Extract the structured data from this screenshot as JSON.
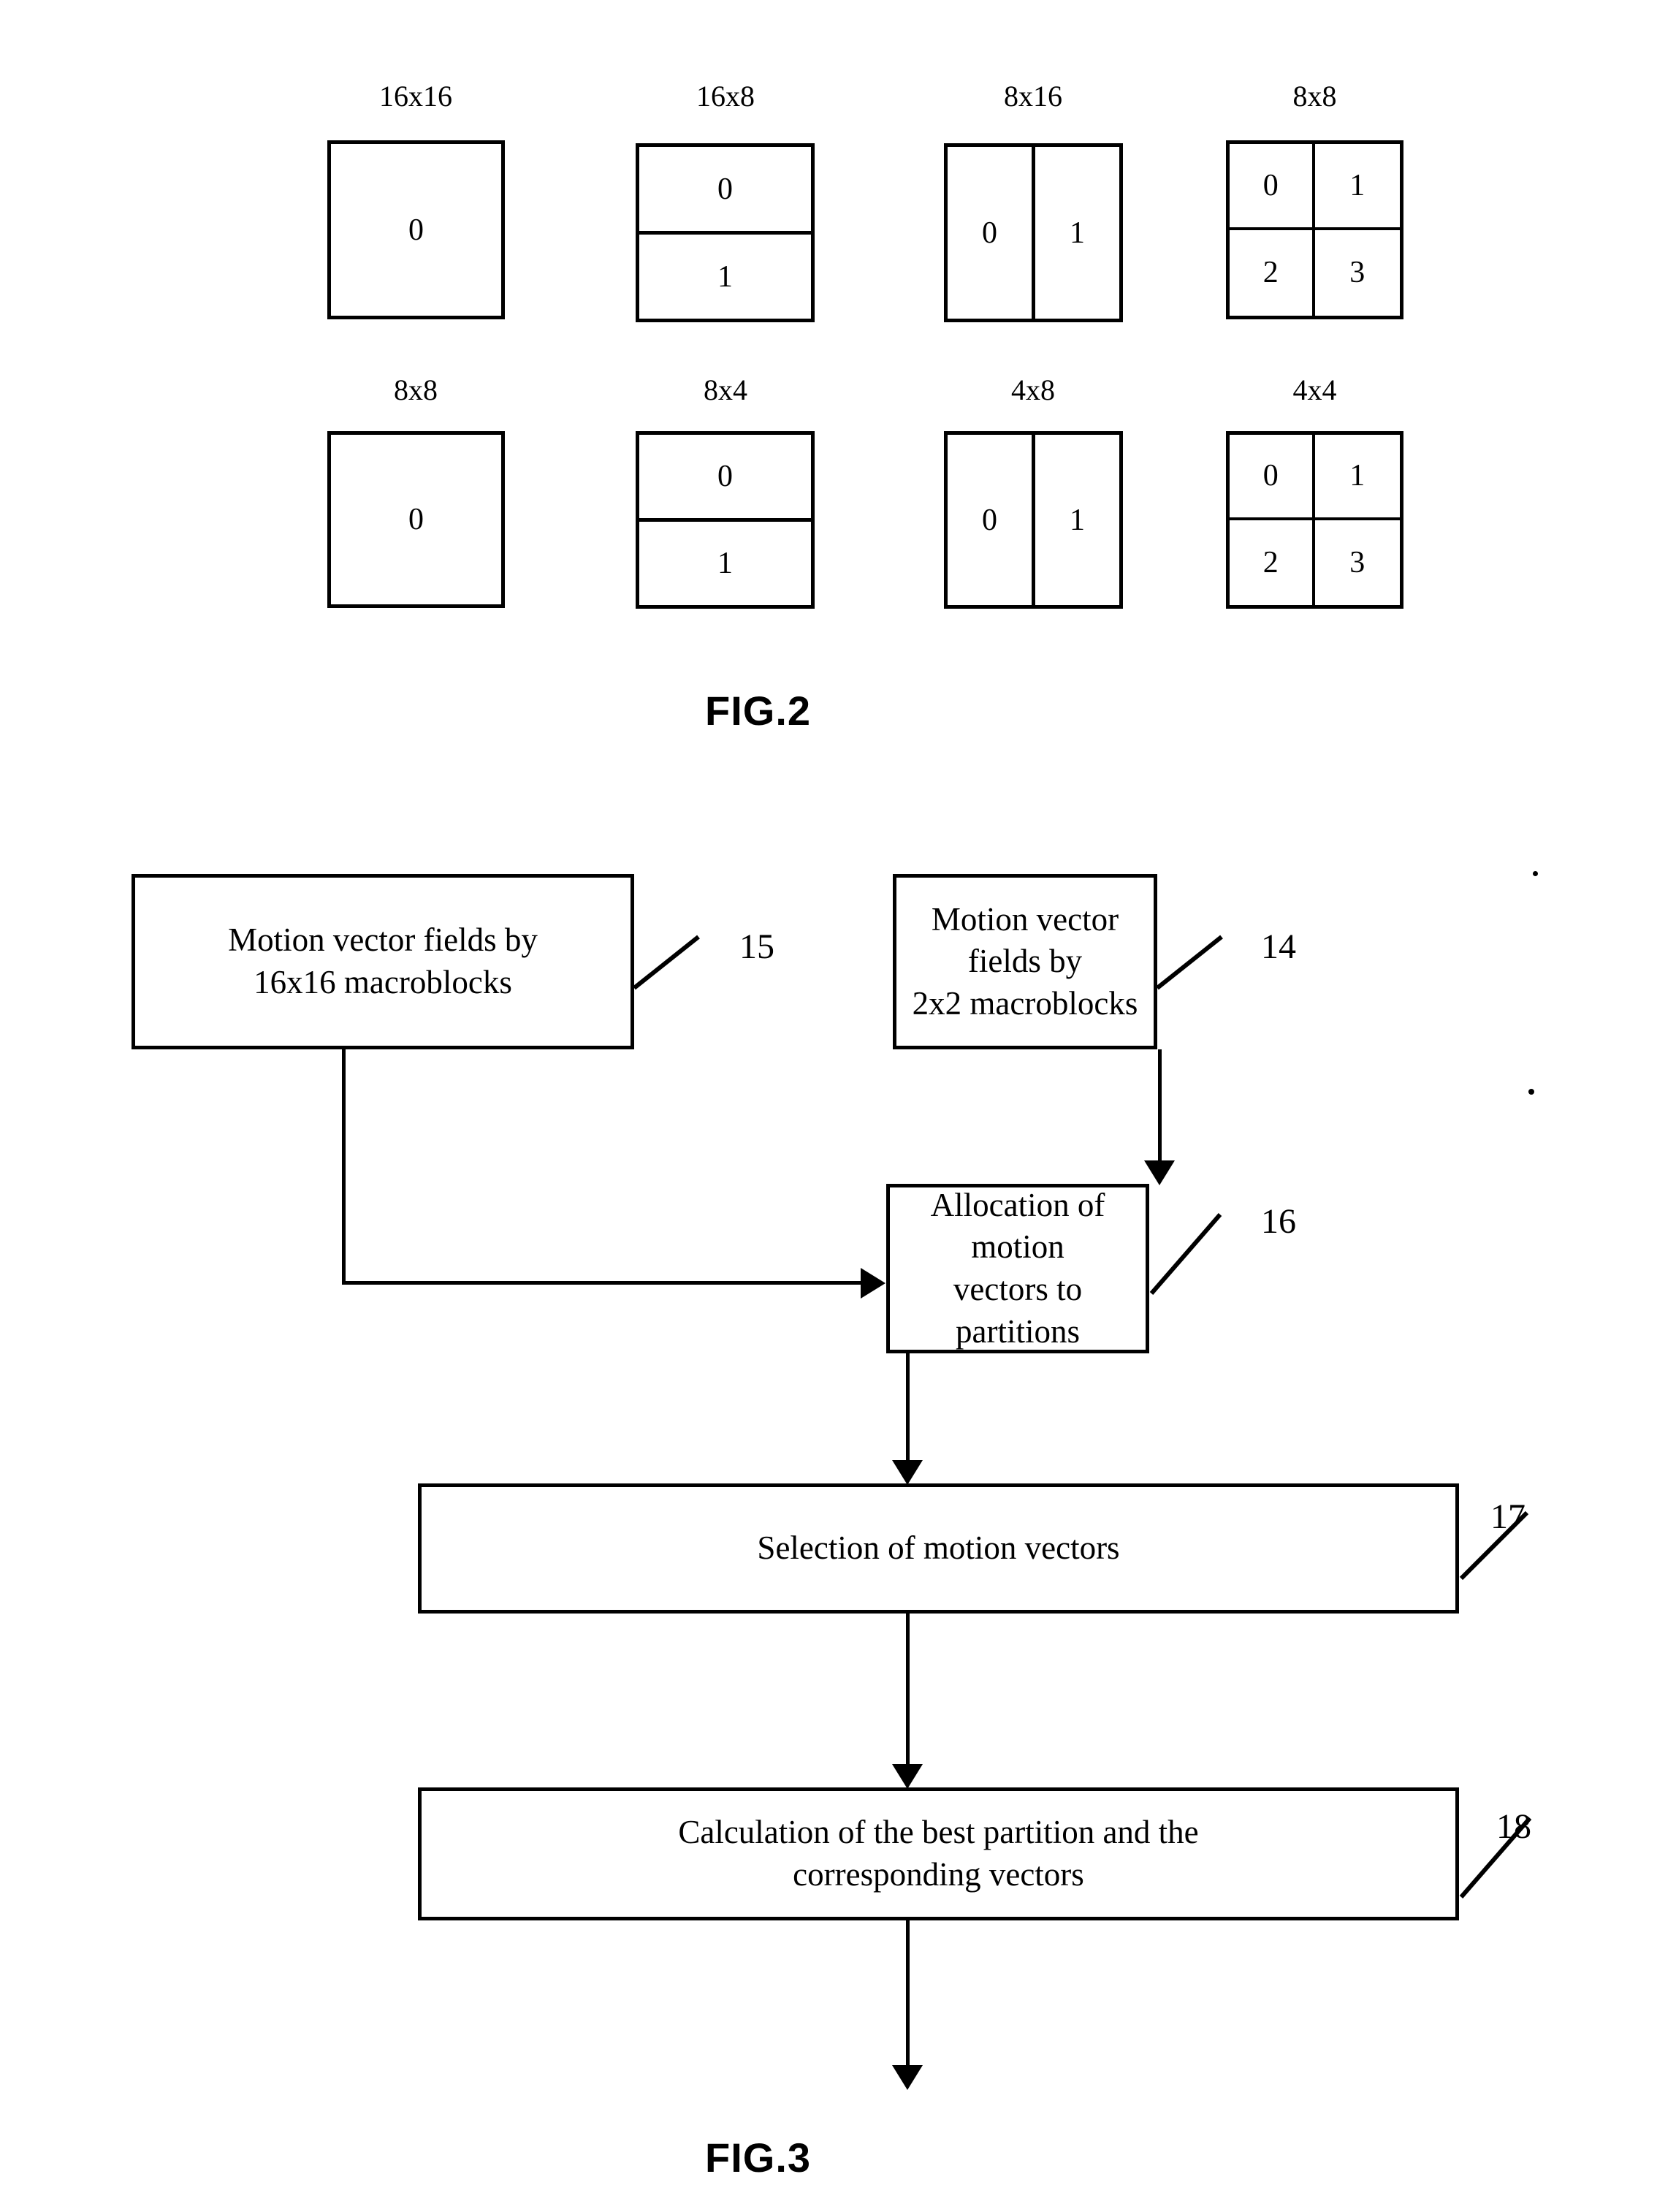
{
  "figures": [
    {
      "caption": "FIG.2",
      "rows": [
        [
          {
            "label": "16x16",
            "type": "single",
            "cells": [
              "0"
            ]
          },
          {
            "label": "16x8",
            "type": "hsplit",
            "cells": [
              "0",
              "1"
            ]
          },
          {
            "label": "8x16",
            "type": "vsplit",
            "cells": [
              "0",
              "1"
            ]
          },
          {
            "label": "8x8",
            "type": "quad",
            "cells": [
              "0",
              "1",
              "2",
              "3"
            ]
          }
        ],
        [
          {
            "label": "8x8",
            "type": "single",
            "cells": [
              "0"
            ]
          },
          {
            "label": "8x4",
            "type": "hsplit",
            "cells": [
              "0",
              "1"
            ]
          },
          {
            "label": "4x8",
            "type": "vsplit",
            "cells": [
              "0",
              "1"
            ]
          },
          {
            "label": "4x4",
            "type": "quad",
            "cells": [
              "0",
              "1",
              "2",
              "3"
            ]
          }
        ]
      ]
    },
    {
      "caption": "FIG.3",
      "boxes": [
        {
          "id": "15",
          "text": "Motion vector fields by\n16x16 macroblocks"
        },
        {
          "id": "14",
          "text": "Motion vector fields by\n2x2 macroblocks"
        },
        {
          "id": "16",
          "text": "Allocation of motion\nvectors to partitions"
        },
        {
          "id": "17",
          "text": "Selection of motion vectors"
        },
        {
          "id": "18",
          "text": "Calculation of the best partition and the\ncorresponding vectors"
        }
      ]
    }
  ],
  "fig2": {
    "caption": "FIG.2",
    "r0": {
      "c0": {
        "label": "16x16",
        "v0": "0"
      },
      "c1": {
        "label": "16x8",
        "v0": "0",
        "v1": "1"
      },
      "c2": {
        "label": "8x16",
        "v0": "0",
        "v1": "1"
      },
      "c3": {
        "label": "8x8",
        "v0": "0",
        "v1": "1",
        "v2": "2",
        "v3": "3"
      }
    },
    "r1": {
      "c0": {
        "label": "8x8",
        "v0": "0"
      },
      "c1": {
        "label": "8x4",
        "v0": "0",
        "v1": "1"
      },
      "c2": {
        "label": "4x8",
        "v0": "0",
        "v1": "1"
      },
      "c3": {
        "label": "4x4",
        "v0": "0",
        "v1": "1",
        "v2": "2",
        "v3": "3"
      }
    }
  },
  "fig3": {
    "caption": "FIG.3",
    "box15": {
      "text": "Motion vector fields by\n16x16 macroblocks",
      "ref": "15"
    },
    "box14": {
      "text": "Motion vector fields by\n2x2 macroblocks",
      "ref": "14"
    },
    "box16": {
      "text": "Allocation of motion\nvectors to partitions",
      "ref": "16"
    },
    "box17": {
      "text": "Selection of motion vectors",
      "ref": "17"
    },
    "box18": {
      "text": "Calculation of the best partition and the\ncorresponding vectors",
      "ref": "18"
    }
  },
  "colors": {
    "ink": "#000000",
    "paper": "#ffffff"
  }
}
